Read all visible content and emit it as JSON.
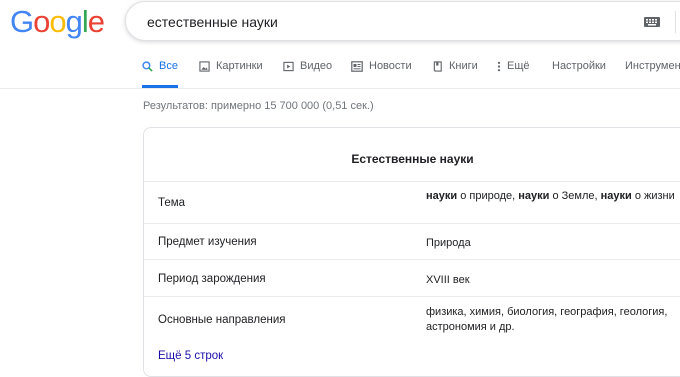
{
  "logo": {
    "text": "Google"
  },
  "search": {
    "query": "естественные науки"
  },
  "tabs": [
    {
      "label": "Все",
      "icon": "search-icon",
      "active": true
    },
    {
      "label": "Картинки",
      "icon": "image-icon"
    },
    {
      "label": "Видео",
      "icon": "video-icon"
    },
    {
      "label": "Новости",
      "icon": "news-icon"
    },
    {
      "label": "Книги",
      "icon": "book-icon"
    },
    {
      "label": "Ещё",
      "icon": "more-vert-icon"
    },
    {
      "label": "Настройки"
    },
    {
      "label": "Инструменты"
    }
  ],
  "result_stats": "Результатов: примерно 15 700 000 (0,51 сек.)",
  "card": {
    "title": "Естественные науки",
    "rows": [
      {
        "label": "Тема",
        "value_parts": [
          "науки",
          " о природе, ",
          "науки",
          " о Земле, ",
          "науки",
          " о жизни"
        ]
      },
      {
        "label": "Предмет изучения",
        "value": "Природа"
      },
      {
        "label": "Период зарождения",
        "value": "XVIII век"
      },
      {
        "label": "Основные направления",
        "value": "физика, химия, биология, география, геология, астрономия и др."
      }
    ],
    "more_link": "Ещё 5 строк"
  },
  "colors": {
    "accent": "#1a73e8",
    "link": "#1a0dab",
    "muted": "#5f6368"
  }
}
